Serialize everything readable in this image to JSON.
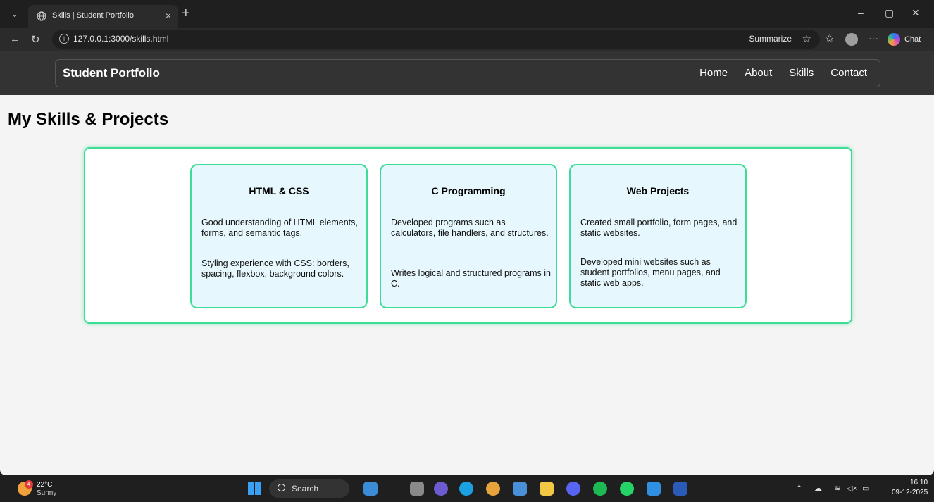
{
  "browser": {
    "tab_title": "Skills | Student Portfolio",
    "tab_close": "×",
    "new_tab": "+",
    "url": "127.0.0.1:3000/skills.html",
    "summarize_label": "Summarize",
    "chat_label": "Chat",
    "window_controls": {
      "minimize": "–",
      "maximize": "▢",
      "close": "✕"
    }
  },
  "site": {
    "brand": "Student Portfolio",
    "nav": [
      "Home",
      "About",
      "Skills",
      "Contact"
    ]
  },
  "page": {
    "title": "My Skills & Projects",
    "cards": [
      {
        "title": "HTML & CSS",
        "paragraphs": [
          "Good understanding of HTML elements, forms, and semantic tags.",
          "Styling experience with CSS: borders, spacing, flexbox, background colors."
        ]
      },
      {
        "title": "C Programming",
        "paragraphs": [
          "Developed programs such as calculators, file handlers, and structures.",
          "Writes logical and structured programs in C."
        ]
      },
      {
        "title": "Web Projects",
        "paragraphs": [
          "Created small portfolio, form pages, and static websites.",
          "Developed mini websites such as student portfolios, menu pages, and static web apps."
        ]
      }
    ]
  },
  "taskbar": {
    "weather_temp": "22°C",
    "weather_desc": "Sunny",
    "weather_badge": "4",
    "search_label": "Search",
    "time": "16:10",
    "date": "09-12-2025"
  },
  "colors": {
    "accent": "#3ddc97",
    "card_bg": "#e6f8fd",
    "header_bg": "#333333"
  }
}
